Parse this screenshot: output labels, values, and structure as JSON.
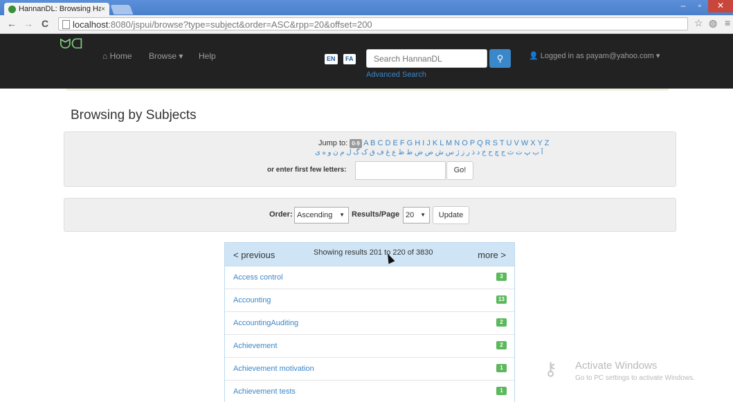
{
  "browser": {
    "tab_title": "HannanDL: Browsing Han",
    "tab_close": "×",
    "url_host": "localhost",
    "url_rest": ":8080/jspui/browse?type=subject&order=ASC&rpp=20&offset=200",
    "back": "←",
    "forward": "→",
    "reload": "C",
    "star": "☆",
    "globe": "◍",
    "menu": "≡",
    "min": "–",
    "max": "▫",
    "close": "✕"
  },
  "header": {
    "logo": "ᗢᗡ",
    "home": "Home",
    "browse": "Browse ▾",
    "help": "Help",
    "lang_en": "EN",
    "lang_fa": "FA",
    "search_placeholder": "Search HannanDL",
    "search_icon": "🔍",
    "advanced": "Advanced Search",
    "user": "Logged in as payam@yahoo.com ▾"
  },
  "page": {
    "title": "Browsing by Subjects",
    "jump_to": "Jump to:",
    "badge_09": "0-9",
    "letters": "A B C D E F G H I J K L M N O P Q R S T U V W X Y Z",
    "arabic_letters": "آ ب پ ت ث ج چ ح خ د ذ ر ز ژ س ش ص ض ط ظ ع غ ف ق ک گ ل م ن و ه ی",
    "enter_label": "or enter first few letters:",
    "go": "Go!",
    "order_label": "Order:",
    "order_value": "Ascending",
    "rpp_label": "Results/Page",
    "rpp_value": "20",
    "update": "Update"
  },
  "results": {
    "prev": "< previous",
    "showing": "Showing results 201 to 220 of 3830",
    "more": "more >",
    "items": [
      {
        "label": "Access control",
        "count": "3"
      },
      {
        "label": "Accounting",
        "count": "13"
      },
      {
        "label": "AccountingAuditing",
        "count": "2"
      },
      {
        "label": "Achievement",
        "count": "2"
      },
      {
        "label": "Achievement motivation",
        "count": "1"
      },
      {
        "label": "Achievement tests",
        "count": "1"
      }
    ]
  },
  "watermark": {
    "title": "Activate Windows",
    "subtitle": "Go to PC settings to activate Windows."
  },
  "colors": {
    "nav_bg": "#222222",
    "link": "#3a87c9",
    "badge": "#5cb85c"
  }
}
